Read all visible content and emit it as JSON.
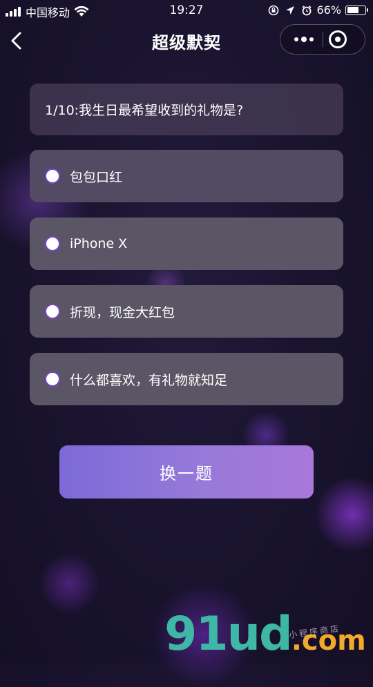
{
  "status_bar": {
    "carrier": "中国移动",
    "time": "19:27",
    "battery_percent": "66%",
    "battery_level": 0.66,
    "icons": [
      "signal-icon",
      "wifi-icon",
      "orientation-lock-icon",
      "location-icon",
      "alarm-icon",
      "battery-icon"
    ]
  },
  "nav": {
    "title": "超级默契",
    "back_icon": "chevron-left-icon",
    "more_icon": "more-dots-icon",
    "close_icon": "target-close-icon"
  },
  "question": {
    "text": "1/10:我生日最希望收到的礼物是?"
  },
  "options": [
    {
      "label": "包包口红"
    },
    {
      "label": "iPhone X"
    },
    {
      "label": "折现，现金大红包"
    },
    {
      "label": "什么都喜欢，有礼物就知足"
    }
  ],
  "swap_button": {
    "label": "换一题"
  },
  "watermark": {
    "main": "91ud",
    "suffix": ".com",
    "sub": "小程序商店"
  },
  "colors": {
    "background": "#1a1430",
    "option_card": "#5b5666",
    "radio_border": "#7a45c9",
    "button_gradient_start": "#7c6ad8",
    "button_gradient_end": "#a878da",
    "watermark_green": "#3fb7a6",
    "watermark_orange": "#f3a92b"
  }
}
